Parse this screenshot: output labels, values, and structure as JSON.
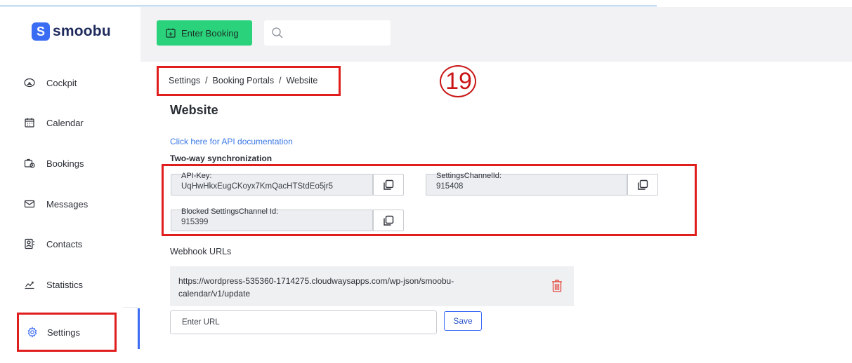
{
  "app": {
    "logo_letter": "S",
    "logo_text": "smoobu",
    "accent": "#3a6cf4",
    "booking_green": "#2bd27c",
    "highlight_red": "#e01e1e"
  },
  "sidebar": {
    "items": [
      {
        "label": "Cockpit",
        "icon": "gauge-icon"
      },
      {
        "label": "Calendar",
        "icon": "calendar-icon"
      },
      {
        "label": "Bookings",
        "icon": "bookings-icon"
      },
      {
        "label": "Messages",
        "icon": "envelope-icon"
      },
      {
        "label": "Contacts",
        "icon": "contact-card-icon"
      },
      {
        "label": "Statistics",
        "icon": "chart-icon"
      },
      {
        "label": "Settings",
        "icon": "gear-icon",
        "active": true
      }
    ]
  },
  "header": {
    "enter_booking_label": "Enter Booking",
    "search_placeholder": ""
  },
  "breadcrumb": {
    "text": "Settings  /  Booking Portals  /  Website"
  },
  "annotation": {
    "step_number": "19"
  },
  "main": {
    "title": "Website",
    "api_link": "Click here for API documentation",
    "sync_title": "Two-way synchronization",
    "fields": {
      "api_key": {
        "label": "API-Key:",
        "value": "UqHwHkxEugCKoyx7KmQacHTStdEo5jr5"
      },
      "channel_id": {
        "label": "SettingsChannelId:",
        "value": "915408"
      },
      "blocked_channel_id": {
        "label": "Blocked SettingsChannel Id:",
        "value": "915399"
      }
    },
    "webhook_title": "Webhook URLs",
    "webhook_url": "https://wordpress-535360-1714275.cloudwaysapps.com/wp-json/smoobu-calendar/v1/update",
    "url_input_placeholder": "Enter URL",
    "save_label": "Save"
  }
}
